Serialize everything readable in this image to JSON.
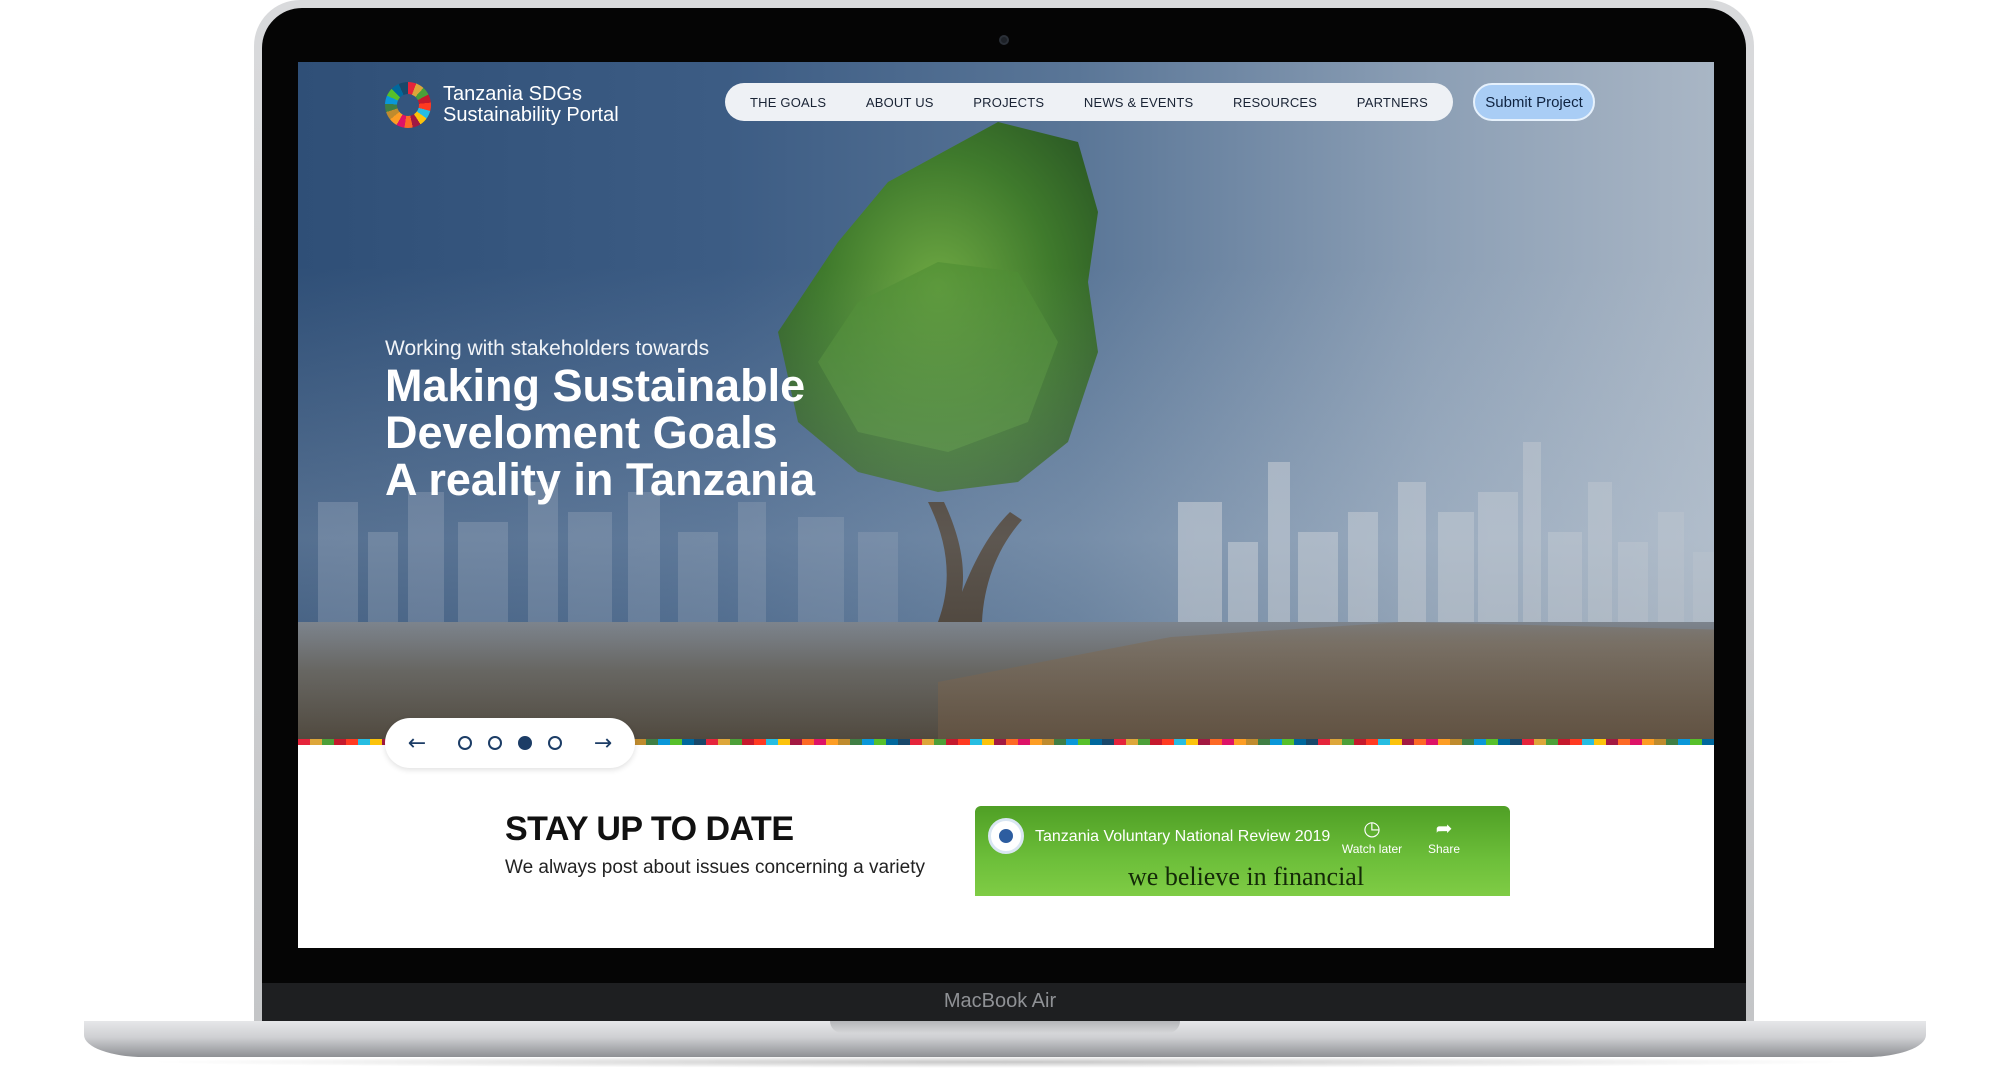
{
  "device": {
    "brand_label": "MacBook Air"
  },
  "header": {
    "logo": {
      "line1": "Tanzania SDGs",
      "line2": "Sustainability Portal"
    },
    "nav": [
      {
        "label": "THE GOALS"
      },
      {
        "label": "ABOUT US"
      },
      {
        "label": "PROJECTS"
      },
      {
        "label": "NEWS & EVENTS"
      },
      {
        "label": "RESOURCES"
      },
      {
        "label": "PARTNERS"
      }
    ],
    "submit_label": "Submit Project"
  },
  "hero": {
    "subtitle": "Working with stakeholders towards",
    "title_lines": [
      "Making Sustainable",
      "Develoment Goals",
      "A reality in Tanzania"
    ]
  },
  "slider": {
    "prev_icon": "arrow-left-icon",
    "next_icon": "arrow-right-icon",
    "slide_count": 4,
    "active_slide": 3
  },
  "stay": {
    "title": "STAY UP TO DATE",
    "text": "We always post about issues concerning a variety"
  },
  "video": {
    "title": "Tanzania Voluntary National Review 2019",
    "watch_later": "Watch later",
    "share": "Share",
    "caption": "we believe in financial"
  },
  "colors": {
    "nav_bg": "#eef1f5",
    "submit_bg": "#a9cdf5",
    "hero_blue": "#2f4f77",
    "slider_accent": "#1c3d66",
    "video_green": "#6dbf3a"
  }
}
